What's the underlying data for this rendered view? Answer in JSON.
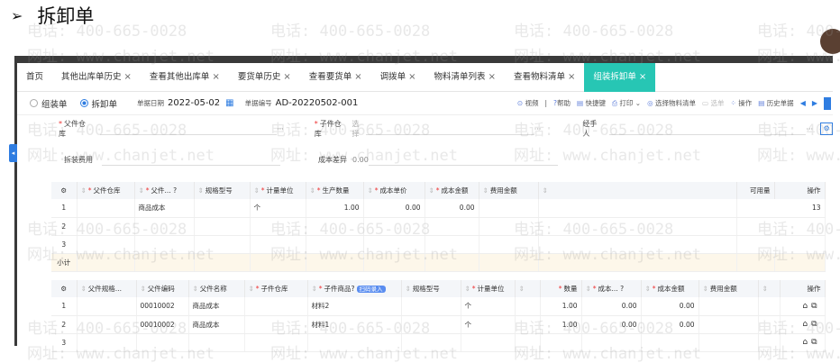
{
  "heading": {
    "bullet": "➢",
    "title": "拆卸单"
  },
  "tabs": [
    {
      "label": "首页",
      "closable": false,
      "active": false
    },
    {
      "label": "其他出库单历史",
      "closable": true,
      "active": false
    },
    {
      "label": "查看其他出库单",
      "closable": true,
      "active": false
    },
    {
      "label": "要货单历史",
      "closable": true,
      "active": false
    },
    {
      "label": "查看要货单",
      "closable": true,
      "active": false
    },
    {
      "label": "调拨单",
      "closable": true,
      "active": false
    },
    {
      "label": "物料清单列表",
      "closable": true,
      "active": false
    },
    {
      "label": "查看物料清单",
      "closable": true,
      "active": false
    },
    {
      "label": "组装拆卸单",
      "closable": true,
      "active": true
    }
  ],
  "close_glyph": "×",
  "toolbar": {
    "radio_assemble": "组装单",
    "radio_disassemble": "拆卸单",
    "date_label": "单据日期",
    "date_value": "2022-05-02",
    "number_label": "单据编号",
    "number_value": "AD-20220502-001",
    "video": "视频",
    "separator": "|",
    "help": "帮助",
    "shortcut": "快捷键",
    "print": "打印",
    "select_bom": "选择物料清单",
    "select_item": "选单",
    "actions": "操作",
    "history": "历史单据"
  },
  "form": {
    "parent_warehouse_label": "父件仓库",
    "child_warehouse_label": "子件仓库",
    "child_warehouse_placeholder": "选择",
    "handler_label": "经手人",
    "ellipsis": "···",
    "disassembly_fee_label": "拆装费用",
    "cost_diff_label": "成本差异",
    "cost_diff_value": "0.00"
  },
  "parent_table": {
    "headers": [
      "父件仓库",
      "父件...",
      "规格型号",
      "计量单位",
      "生产数量",
      "成本单价",
      "成本金额",
      "费用金额",
      "",
      "可用量",
      "操作"
    ],
    "rows": [
      {
        "idx": "1",
        "warehouse": "",
        "item": "商品成本",
        "spec": "",
        "unit": "个",
        "qty": "1.00",
        "price": "0.00",
        "amount": "0.00",
        "fee": "",
        "blank": "",
        "available": "13"
      },
      {
        "idx": "2",
        "warehouse": "",
        "item": "",
        "spec": "",
        "unit": "",
        "qty": "",
        "price": "",
        "amount": "",
        "fee": "",
        "blank": "",
        "available": ""
      },
      {
        "idx": "3",
        "warehouse": "",
        "item": "",
        "spec": "",
        "unit": "",
        "qty": "",
        "price": "",
        "amount": "",
        "fee": "",
        "blank": "",
        "available": ""
      }
    ],
    "subtotal_label": "小计"
  },
  "child_table": {
    "headers": [
      "父件规格...",
      "父件编码",
      "父件名称",
      "子件仓库",
      "子件商品",
      "规格型号",
      "计量单位",
      "",
      "数量",
      "成本...",
      "成本金额",
      "费用金额",
      "",
      "操作"
    ],
    "batch_entry": "扫码录入",
    "rows": [
      {
        "idx": "1",
        "spec": "",
        "code": "00010002",
        "name": "商品成本",
        "warehouse": "",
        "child": "材料2",
        "cspec": "",
        "unit": "个",
        "blank": "",
        "qty": "1.00",
        "price": "0.00",
        "amount": "0.00",
        "fee": "",
        "blank2": ""
      },
      {
        "idx": "2",
        "spec": "",
        "code": "00010002",
        "name": "商品成本",
        "warehouse": "",
        "child": "材料1",
        "cspec": "",
        "unit": "个",
        "blank": "",
        "qty": "1.00",
        "price": "0.00",
        "amount": "0.00",
        "fee": "",
        "blank2": ""
      },
      {
        "idx": "3",
        "spec": "",
        "code": "",
        "name": "",
        "warehouse": "",
        "child": "",
        "cspec": "",
        "unit": "",
        "blank": "",
        "qty": "",
        "price": "",
        "amount": "",
        "fee": "",
        "blank2": ""
      }
    ]
  },
  "watermarks": {
    "phone": "电话: 400-665-0028",
    "site": "网址: www.chanjet.net"
  },
  "colors": {
    "active_tab": "#27c6b4",
    "accent": "#2f7de1"
  }
}
